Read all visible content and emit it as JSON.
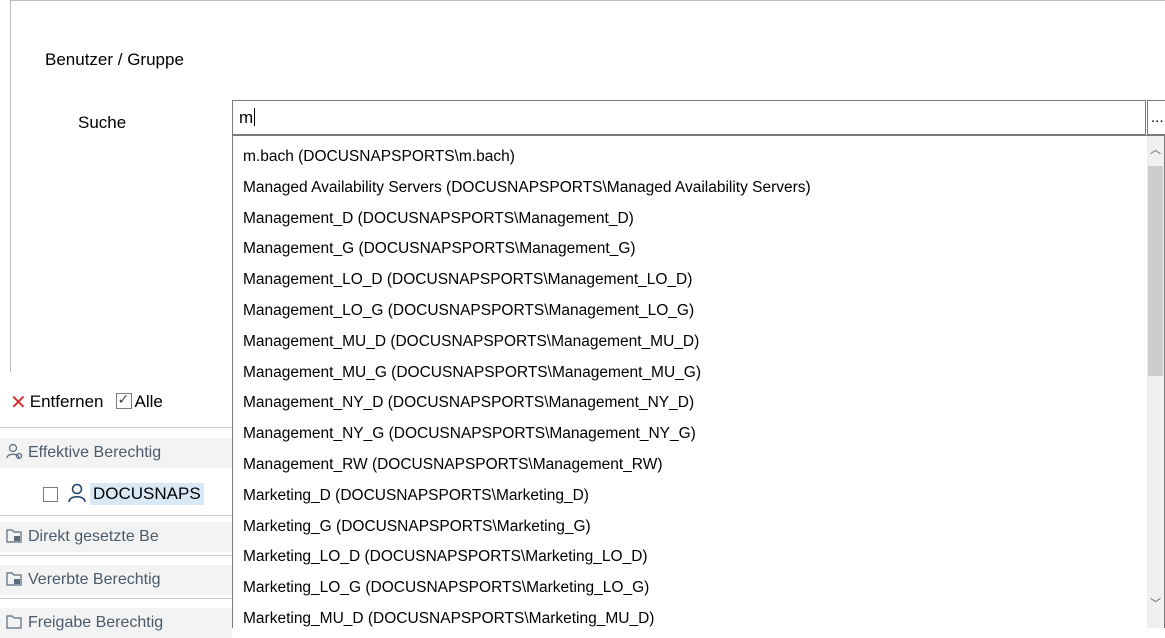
{
  "group": {
    "title": "Benutzer / Gruppe"
  },
  "search": {
    "label": "Suche",
    "value": "m",
    "browse_label": "..."
  },
  "dropdown": {
    "items": [
      "m.bach (DOCUSNAPSPORTS\\m.bach)",
      "Managed Availability Servers (DOCUSNAPSPORTS\\Managed Availability Servers)",
      "Management_D (DOCUSNAPSPORTS\\Management_D)",
      "Management_G (DOCUSNAPSPORTS\\Management_G)",
      "Management_LO_D (DOCUSNAPSPORTS\\Management_LO_D)",
      "Management_LO_G (DOCUSNAPSPORTS\\Management_LO_G)",
      "Management_MU_D (DOCUSNAPSPORTS\\Management_MU_D)",
      "Management_MU_G (DOCUSNAPSPORTS\\Management_MU_G)",
      "Management_NY_D (DOCUSNAPSPORTS\\Management_NY_D)",
      "Management_NY_G (DOCUSNAPSPORTS\\Management_NY_G)",
      "Management_RW (DOCUSNAPSPORTS\\Management_RW)",
      "Marketing_D (DOCUSNAPSPORTS\\Marketing_D)",
      "Marketing_G (DOCUSNAPSPORTS\\Marketing_G)",
      "Marketing_LO_D (DOCUSNAPSPORTS\\Marketing_LO_D)",
      "Marketing_LO_G (DOCUSNAPSPORTS\\Marketing_LO_G)",
      "Marketing_MU_D (DOCUSNAPSPORTS\\Marketing_MU_D)"
    ],
    "scroll_up_icon": "chevron-up-icon",
    "scroll_down_icon": "chevron-down-icon"
  },
  "toolbar": {
    "remove_label": "Entfernen",
    "all_label": "Alle",
    "all_checked": true
  },
  "tree": {
    "effective_label": "Effektive Berechtig",
    "user_label": "DOCUSNAPS",
    "direct_label": "Direkt gesetzte Be",
    "inherited_label": "Vererbte Berechtig",
    "share_label": "Freigabe Berechtig"
  },
  "colors": {
    "remove_icon": "#d32f2f",
    "selection": "#d9e8f5",
    "row_bg": "#f3f3f3"
  }
}
